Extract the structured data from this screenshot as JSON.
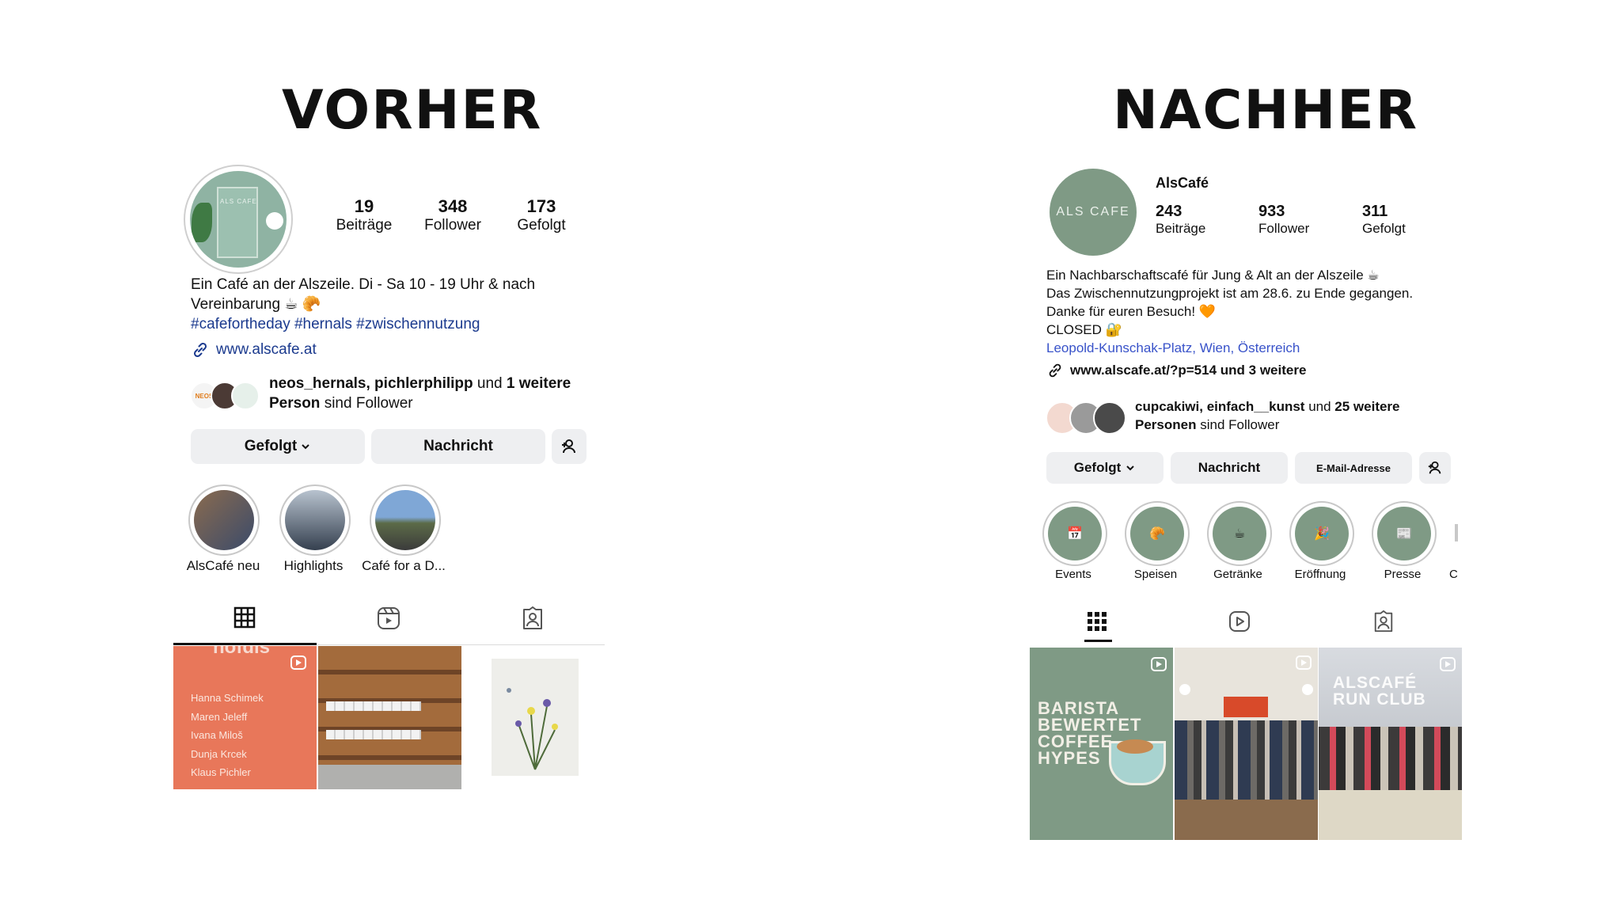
{
  "headings": {
    "before": "VORHER",
    "after": "NACHHER"
  },
  "before": {
    "avatar_text": "ALS CAFE",
    "stats": [
      {
        "value": "19",
        "label": "Beiträge"
      },
      {
        "value": "348",
        "label": "Follower"
      },
      {
        "value": "173",
        "label": "Gefolgt"
      }
    ],
    "bio_line1": "Ein Café an der Alszeile. Di - Sa 10 - 19 Uhr & nach",
    "bio_line2": "Vereinbarung ☕ 🥐",
    "hashtags": "#cafefortheday #hernals #zwischennutzung",
    "website": "www.alscafe.at",
    "followers_names": "neos_hernals, pichlerphilipp",
    "followers_und": " und ",
    "followers_more": "1 weitere",
    "followers_line2_bold": "Person",
    "followers_line2_rest": " sind Follower",
    "buttons": {
      "following": "Gefolgt",
      "message": "Nachricht"
    },
    "highlights": [
      {
        "label": "AlsCafé neu"
      },
      {
        "label": "Highlights"
      },
      {
        "label": "Café for a D..."
      }
    ],
    "grid": {
      "tile1_title": "hofdis",
      "tile1_names": [
        "Hanna Schimek",
        "Maren Jeleff",
        "Ivana Miloš",
        "Dunja Krcek",
        "Klaus Pichler"
      ]
    }
  },
  "after": {
    "avatar_text": "ALS CAFE",
    "username": "AlsCafé",
    "stats": [
      {
        "value": "243",
        "label": "Beiträge"
      },
      {
        "value": "933",
        "label": "Follower"
      },
      {
        "value": "311",
        "label": "Gefolgt"
      }
    ],
    "bio_line1": "Ein Nachbarschaftscafé für Jung & Alt an der Alszeile ☕",
    "bio_line2": "Das Zwischennutzungprojekt ist am 28.6. zu Ende gegangen.",
    "bio_line3": "Danke für euren Besuch! 🧡",
    "bio_line4": "CLOSED 🔐",
    "location": "Leopold-Kunschak-Platz, Wien, Österreich",
    "website": "www.alscafe.at/?p=514 und 3 weitere",
    "followers_names": "cupcakiwi, einfach__kunst",
    "followers_und": " und ",
    "followers_more": "25 weitere",
    "followers_line2_bold": "Personen",
    "followers_line2_rest": " sind Follower",
    "buttons": {
      "following": "Gefolgt",
      "message": "Nachricht",
      "email": "E-Mail-Adresse"
    },
    "highlights": [
      {
        "label": "Events",
        "icon": "📅"
      },
      {
        "label": "Speisen",
        "icon": "🥐"
      },
      {
        "label": "Getränke",
        "icon": "☕"
      },
      {
        "label": "Eröffnung",
        "icon": "🎉"
      },
      {
        "label": "Presse",
        "icon": "📰"
      }
    ],
    "highlight_partial": "C",
    "grid": {
      "tile1_text": [
        "BARISTA",
        "BEWERTET",
        "COFFEE",
        "HYPES"
      ],
      "tile3_text": [
        "ALSCAFÉ",
        "RUN CLUB"
      ]
    }
  },
  "colors": {
    "sage": "#7f9a85",
    "orange": "#e8775a",
    "link_blue": "#1b3a8e",
    "button_gray": "#eeeff1"
  }
}
